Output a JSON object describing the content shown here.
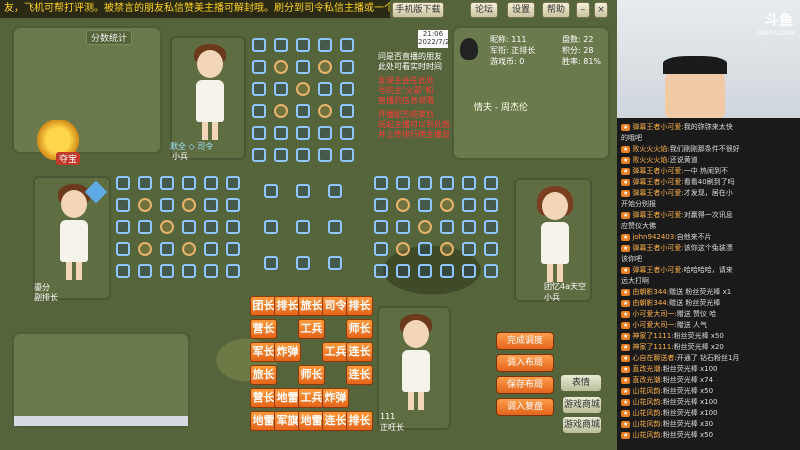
{
  "ticker": "友，飞机可帮打评测。被禁言的朋友私信赞美主播可解封哦。刷分到司令私信主播或一个飞机。 火箭",
  "top_buttons": [
    "手机版下载",
    "论坛",
    "设置",
    "帮助"
  ],
  "score_panel": {
    "title": "分数统计"
  },
  "treasure_label": "夺宝",
  "players": {
    "top": {
      "name": "小兵",
      "tag": "默全 ◇ 司令"
    },
    "left": {
      "name": "鎏分",
      "rank": "副排长"
    },
    "right": {
      "name": "团忆4a天空",
      "rank": "小兵"
    },
    "bottom": {
      "name": "正旺长",
      "score": "111"
    }
  },
  "clock": {
    "time": "21:06",
    "date": "2022/7/2"
  },
  "notes": {
    "question": "问是否直播的朋友\n此处可看实时时间",
    "red1": "友缘主会在此处\n号的主\"火箭\"和\n直播的信息说哦",
    "red2": "开播配方结束后\n玩起主播可以到处跑\n并上传排行榜主播显"
  },
  "profile": {
    "nick_label": "昵称:",
    "nick": "111",
    "rank_label": "军衔:",
    "rank": "正排长",
    "coins_label": "游戏币:",
    "coins": "0",
    "games_label": "盘数:",
    "games": "22",
    "score_label": "积分:",
    "score": "28",
    "winrate_label": "胜率:",
    "winrate": "81%",
    "song": "情夫 - 周杰伦"
  },
  "pieces": [
    [
      "团长",
      "排长",
      "旅长",
      "司令",
      "排长"
    ],
    [
      "营长",
      "",
      "工兵",
      "",
      "师长"
    ],
    [
      "军长",
      "炸弹",
      "",
      "工兵",
      "连长"
    ],
    [
      "旅长",
      "",
      "师长",
      "",
      "连长"
    ],
    [
      "营长",
      "地雷",
      "工兵",
      "炸弹",
      ""
    ],
    [
      "地雷",
      "军旗",
      "地雷",
      "连长",
      "排长"
    ]
  ],
  "action_buttons": [
    "完成调度",
    "调入布局",
    "保存布局",
    "调入复盘"
  ],
  "side_buttons": [
    "表情",
    "游戏商城",
    "游戏商城"
  ],
  "stream": {
    "logo": "斗鱼",
    "sub": "DOUYU.COM"
  },
  "chat": [
    {
      "user": "弹幕王者小可爱:",
      "text": "我的弥弥来太快"
    },
    {
      "user": "",
      "text": "的哦吧"
    },
    {
      "user": "败火火火焰:",
      "text": "我们刚刚那条件不很好"
    },
    {
      "user": "败火火火焰:",
      "text": "还说黄道"
    },
    {
      "user": "弹幕王者小可爱:",
      "text": "一中 热闹到不"
    },
    {
      "user": "弹幕王者小可爱:",
      "text": "看看40刷到了吗"
    },
    {
      "user": "弹幕王者小可爱:",
      "text": "才发现，居在小"
    },
    {
      "user": "",
      "text": "开始分别报"
    },
    {
      "user": "弹幕王者小可爱:",
      "text": "对赢得一次讯息"
    },
    {
      "user": "",
      "text": "应赞仪大佛"
    },
    {
      "user": "john942403:",
      "text": "自他来不片"
    },
    {
      "user": "弹幕王者小可爱:",
      "text": "该你这个兔装漂"
    },
    {
      "user": "",
      "text": "该你吧"
    },
    {
      "user": "弹幕王者小可爱:",
      "text": "哈哈哈哈，请来"
    },
    {
      "user": "",
      "text": "远大打啊"
    },
    {
      "user": "由朝影344:",
      "text": "赠送 粉丝荧光棒 x1"
    },
    {
      "user": "由朝影344:",
      "text": "赠送 粉丝荧光棒"
    },
    {
      "user": "小可爱大司一:",
      "text": "赠送 赞仪 哈"
    },
    {
      "user": "小可爱大司一:",
      "text": "赠送 人气"
    },
    {
      "user": "神家了1111:",
      "text": "粉丝荧光棒 x50"
    },
    {
      "user": "神家了1111:",
      "text": "粉丝荧光棒 x20"
    },
    {
      "user": "心自在聊送者:",
      "text": "开通了 钻石粉丝1月"
    },
    {
      "user": "直改光潮:",
      "text": "粉丝荧光棒 x100"
    },
    {
      "user": "直改光潮:",
      "text": "粉丝荧光棒 x74"
    },
    {
      "user": "山花风韵:",
      "text": "粉丝荧光棒 x50"
    },
    {
      "user": "山花风韵:",
      "text": "粉丝荧光棒 x100"
    },
    {
      "user": "山花风韵:",
      "text": "粉丝荧光棒 x100"
    },
    {
      "user": "山花风韵:",
      "text": "粉丝荧光棒 x30"
    },
    {
      "user": "山花风韵:",
      "text": "粉丝荧光棒 x50"
    }
  ]
}
